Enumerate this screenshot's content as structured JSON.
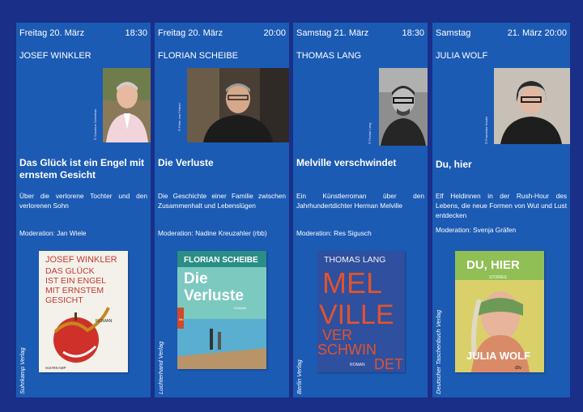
{
  "events": [
    {
      "date": "Freitag 20. März",
      "time": "18:30",
      "author": "JOSEF WINKLER",
      "photo_credit": "© Suzanne Schwiertz",
      "title": "Das Glück ist ein Engel mit ernstem Gesicht",
      "description": "Über die verlorene Tochter und den verlorenen Sohn",
      "moderation": "Moderation:  Jan Wiele",
      "publisher": "Suhrkamp Verlag",
      "cover": {
        "author": "JOSEF WINKLER",
        "title_lines": [
          "DAS GLÜCK",
          "IST EIN ENGEL",
          "MIT ERNSTEM",
          "GESICHT"
        ],
        "genre": "ROMAN",
        "publisher_mark": "SUHRKAMP"
      }
    },
    {
      "date": "Freitag 20. März",
      "time": "20:00",
      "author": "FLORIAN SCHEIBE",
      "photo_credit": "© Peter von Felbert",
      "title": "Die Verluste",
      "description": "Die Geschichte einer Familie zwischen Zusammenhalt und Lebenslügen",
      "moderation": "Moderation: Nadine Kreuzahler (rbb)",
      "publisher": "Luchterhand Verlag",
      "cover": {
        "author": "FLORIAN SCHEIBE",
        "title_lines": [
          "Die",
          "Verluste"
        ],
        "genre": "ROMAN",
        "publisher_mark": "btb"
      }
    },
    {
      "date": "Samstag 21. März",
      "time": "18:30",
      "author": "THOMAS LANG",
      "photo_credit": "© Florian Lang",
      "title": "Melville verschwindet",
      "description": "Ein Künstlerroman über den Jahrhundertdichter Herman Melville",
      "moderation": "Moderation: Res Sigusch",
      "publisher": "Berlin Verlag",
      "cover": {
        "author": "THOMAS LANG",
        "title_lines": [
          "MEL",
          "VILLE",
          "VER",
          "SCHWIN",
          "DET"
        ],
        "genre": "ROMAN"
      }
    },
    {
      "date": "Samstag",
      "time": "21. März 20:00",
      "author": "JULIA WOLF",
      "photo_credit": "© Franziska Hauke",
      "title": "Du, hier",
      "description": "Elf Heldinnen in der Rush-Hour des Lebens, die neue Formen von Wut und Lust entdecken",
      "moderation": "Moderation: Svenja Gräfen",
      "publisher": "Deutscher Taschenbuch Verlag",
      "cover": {
        "title_lines": [
          "DU, HIER"
        ],
        "subtitle": "STORIES",
        "author": "JULIA WOLF",
        "publisher_mark": "dtv"
      }
    }
  ],
  "colors": {
    "background": "#1a2f88",
    "panel": "#1c5bb4",
    "text": "#ffffff"
  }
}
